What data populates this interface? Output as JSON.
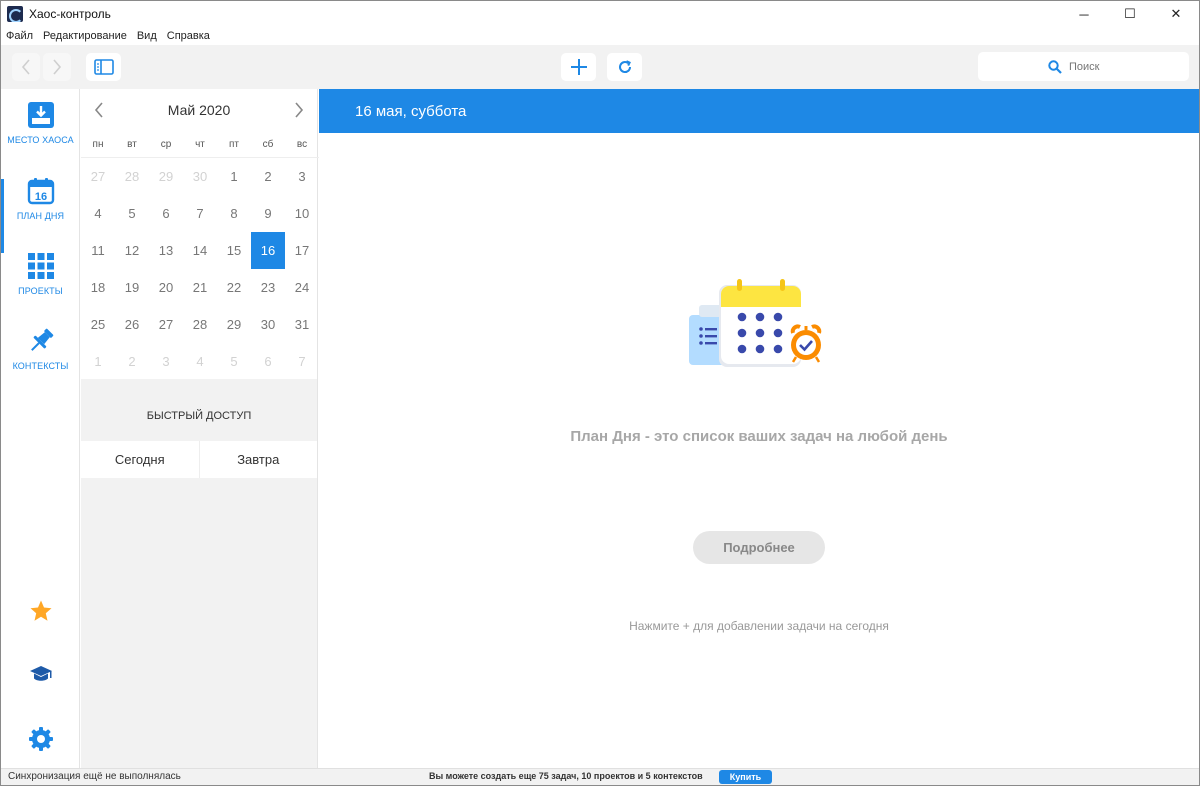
{
  "window": {
    "title": "Хаос-контроль",
    "controls": [
      "─",
      "☐",
      "✕"
    ]
  },
  "menu": [
    "Файл",
    "Редактирование",
    "Вид",
    "Справка"
  ],
  "toolbar": {
    "search_placeholder": "Поиск"
  },
  "nav": {
    "items": [
      {
        "label": "МЕСТО ХАОСА",
        "icon": "inbox-icon"
      },
      {
        "label": "ПЛАН ДНЯ",
        "icon": "calendar-16-icon",
        "date": "16"
      },
      {
        "label": "ПРОЕКТЫ",
        "icon": "grid-icon"
      },
      {
        "label": "КОНТЕКСТЫ",
        "icon": "pin-icon"
      }
    ]
  },
  "calendar": {
    "title": "Май 2020",
    "weekdays": [
      "пн",
      "вт",
      "ср",
      "чт",
      "пт",
      "сб",
      "вс"
    ],
    "days": [
      {
        "d": "27",
        "m": true
      },
      {
        "d": "28",
        "m": true
      },
      {
        "d": "29",
        "m": true
      },
      {
        "d": "30",
        "m": true
      },
      {
        "d": "1"
      },
      {
        "d": "2"
      },
      {
        "d": "3"
      },
      {
        "d": "4"
      },
      {
        "d": "5"
      },
      {
        "d": "6"
      },
      {
        "d": "7"
      },
      {
        "d": "8"
      },
      {
        "d": "9"
      },
      {
        "d": "10"
      },
      {
        "d": "11"
      },
      {
        "d": "12"
      },
      {
        "d": "13"
      },
      {
        "d": "14"
      },
      {
        "d": "15"
      },
      {
        "d": "16",
        "s": true
      },
      {
        "d": "17"
      },
      {
        "d": "18"
      },
      {
        "d": "19"
      },
      {
        "d": "20"
      },
      {
        "d": "21"
      },
      {
        "d": "22"
      },
      {
        "d": "23"
      },
      {
        "d": "24"
      },
      {
        "d": "25"
      },
      {
        "d": "26"
      },
      {
        "d": "27"
      },
      {
        "d": "28"
      },
      {
        "d": "29"
      },
      {
        "d": "30"
      },
      {
        "d": "31"
      },
      {
        "d": "1",
        "m": true
      },
      {
        "d": "2",
        "m": true
      },
      {
        "d": "3",
        "m": true
      },
      {
        "d": "4",
        "m": true
      },
      {
        "d": "5",
        "m": true
      },
      {
        "d": "6",
        "m": true
      },
      {
        "d": "7",
        "m": true
      }
    ],
    "quick_access_title": "БЫСТРЫЙ ДОСТУП",
    "today_label": "Сегодня",
    "tomorrow_label": "Завтра"
  },
  "main": {
    "header": "16 мая, суббота",
    "empty_title": "План Дня - это список ваших задач на любой день",
    "more_button": "Подробнее",
    "hint": "Нажмите + для добавлении задачи на сегодня"
  },
  "status": {
    "sync": "Синхронизация ещё не выполнялась",
    "limits": "Вы можете создать еще 75 задач, 10 проектов и 5 контекстов",
    "buy_button": "Купить"
  },
  "colors": {
    "accent": "#1e88e5",
    "star": "#ffa726",
    "panel": "#f2f2f2"
  }
}
